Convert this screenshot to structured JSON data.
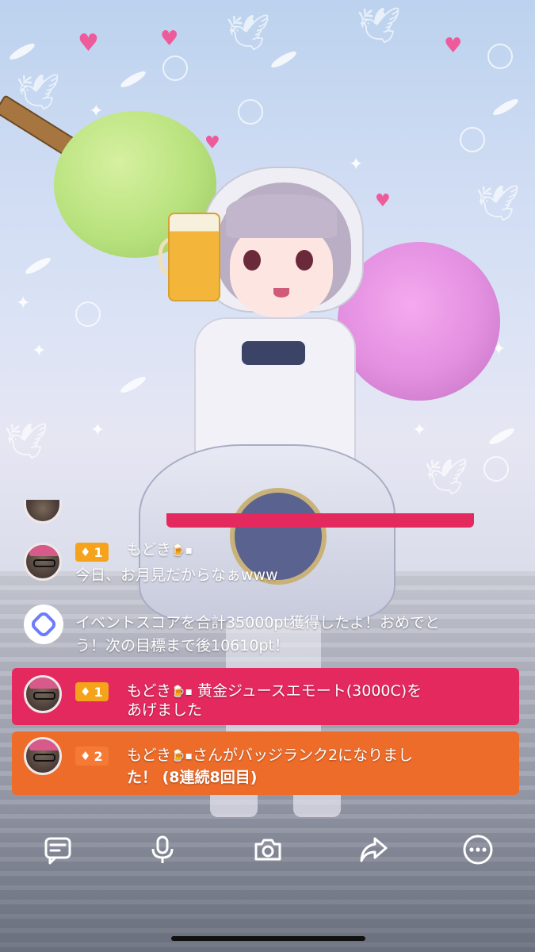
{
  "chat": {
    "partial_row": {},
    "message1": {
      "badge_level": "1",
      "username": "もどき",
      "text": "今日、お月見だからなぁwww"
    },
    "system_message": {
      "text_line1": "イベントスコアを合計35000pt獲得したよ！おめでと",
      "text_line2": "う！次の目標まで後10610pt！"
    },
    "gift_message": {
      "badge_level": "1",
      "username": "もどき",
      "text_suffix": "黄金ジュースエモート(3000C)を",
      "text_line2": "あげました"
    },
    "rank_message": {
      "badge_level": "2",
      "username": "もどき",
      "text_suffix": "さんがバッジランク2になりまし",
      "text_line2": "た！ (8連続8回目)"
    }
  },
  "toolbar": {
    "items": [
      {
        "name": "comment-icon"
      },
      {
        "name": "microphone-icon"
      },
      {
        "name": "camera-icon"
      },
      {
        "name": "share-icon"
      },
      {
        "name": "more-icon"
      }
    ]
  },
  "colors": {
    "gift_row": "#e4295f",
    "rank_row": "#ee6c2a",
    "badge_gold": "#f4a31a"
  }
}
